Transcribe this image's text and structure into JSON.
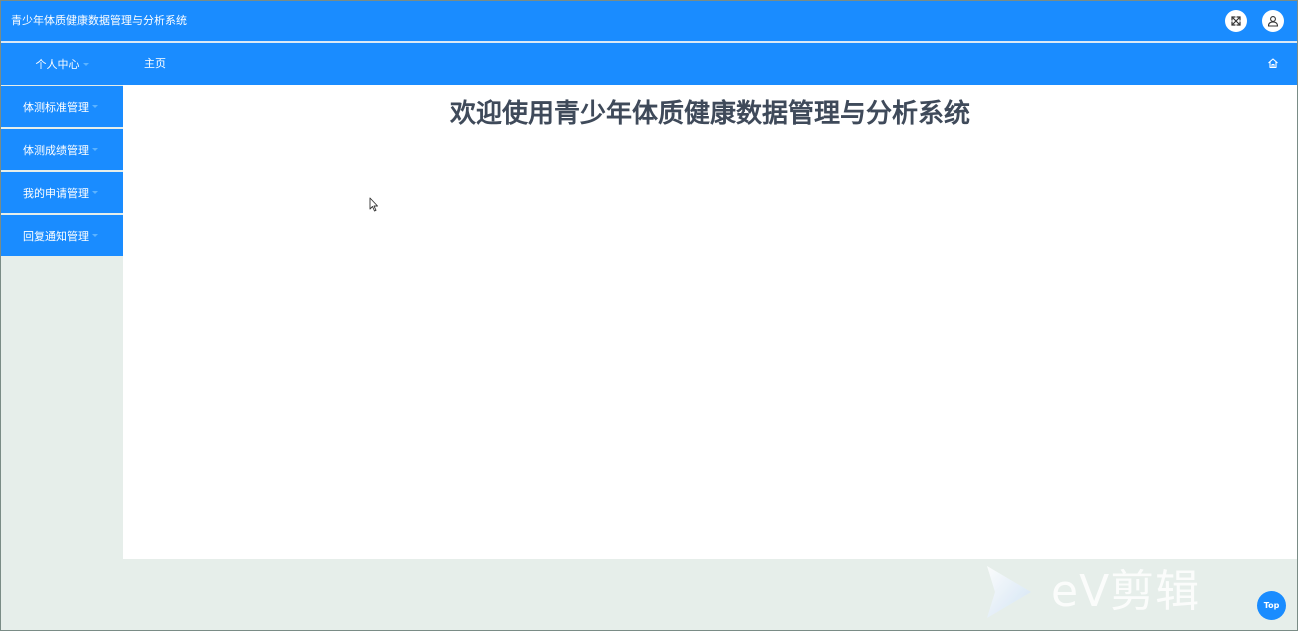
{
  "app": {
    "title": "青少年体质健康数据管理与分析系统"
  },
  "topbar": {
    "icons": [
      "fullscreen-toggle-icon",
      "user-icon"
    ]
  },
  "nav": {
    "personal_center": "个人中心",
    "home": "主页",
    "home_icon": "home-icon"
  },
  "sidebar": {
    "items": [
      {
        "label": "体测标准管理"
      },
      {
        "label": "体测成绩管理"
      },
      {
        "label": "我的申请管理"
      },
      {
        "label": "回复通知管理"
      }
    ]
  },
  "main": {
    "welcome": "欢迎使用青少年体质健康数据管理与分析系统"
  },
  "watermark": {
    "text": "eV剪辑"
  },
  "back_to_top": {
    "label": "Top"
  },
  "colors": {
    "primary": "#1a8cff",
    "background": "#e6eeea",
    "heading": "#3f4a5a"
  }
}
